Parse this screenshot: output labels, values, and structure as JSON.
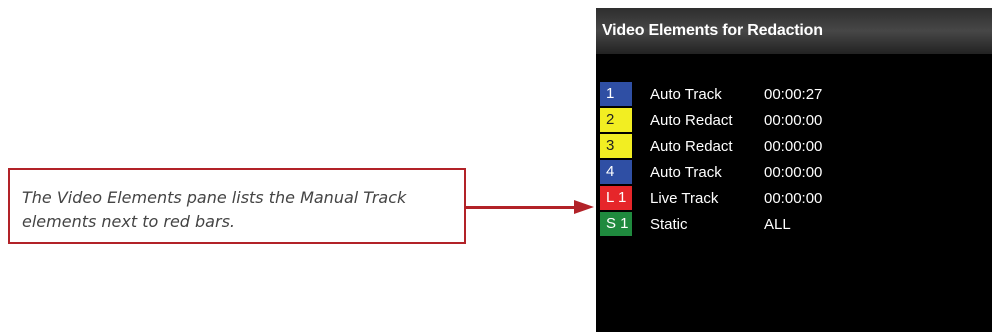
{
  "callout": {
    "text": "The Video Elements pane lists the Manual Track elements next to red bars."
  },
  "panel": {
    "title": "Video Elements for Redaction",
    "rows": [
      {
        "id": "1",
        "label": "Auto Track",
        "time": "00:00:27",
        "color": "#2f4fa4",
        "text_color": "#ffffff"
      },
      {
        "id": "2",
        "label": "Auto Redact",
        "time": "00:00:00",
        "color": "#f2ee22",
        "text_color": "#222222"
      },
      {
        "id": "3",
        "label": "Auto Redact",
        "time": "00:00:00",
        "color": "#f2ee22",
        "text_color": "#222222"
      },
      {
        "id": "4",
        "label": "Auto Track",
        "time": "00:00:00",
        "color": "#2f4fa4",
        "text_color": "#ffffff"
      },
      {
        "id": "L 1",
        "label": "Live Track",
        "time": "00:00:00",
        "color": "#e6262a",
        "text_color": "#ffffff"
      },
      {
        "id": "S 1",
        "label": "Static",
        "time": "ALL",
        "color": "#1f8a3e",
        "text_color": "#ffffff"
      }
    ]
  }
}
